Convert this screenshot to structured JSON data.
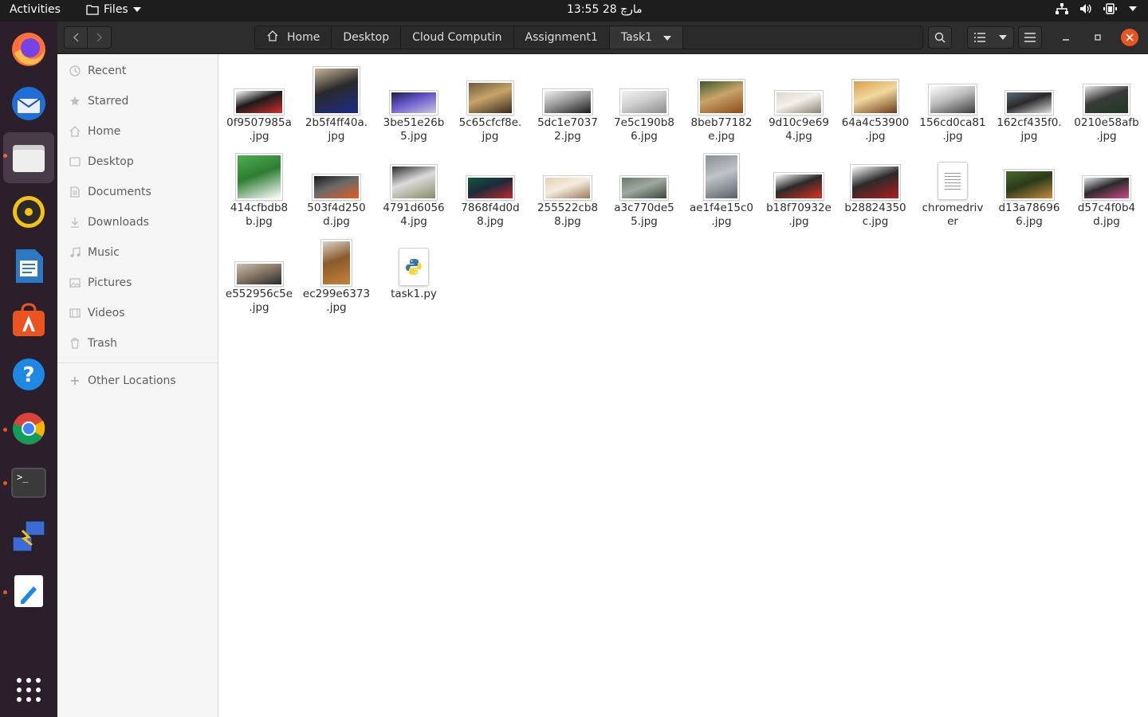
{
  "topbar": {
    "activities": "Activities",
    "app_menu": "Files",
    "clock": "مارچ 28  13:55"
  },
  "dock": {
    "apps": [
      {
        "name": "firefox",
        "color": "#ff7139"
      },
      {
        "name": "thunderbird",
        "color": "#2a6fd6"
      },
      {
        "name": "files",
        "color": "#9b9b9b"
      },
      {
        "name": "rhythmbox",
        "color": "#f5c211"
      },
      {
        "name": "libreoffice-writer",
        "color": "#2b78c5"
      },
      {
        "name": "ubuntu-software",
        "color": "#e95420"
      },
      {
        "name": "help",
        "color": "#1e88e5"
      },
      {
        "name": "chrome",
        "color": "#4285f4"
      },
      {
        "name": "terminal",
        "color": "#3a3a3a"
      },
      {
        "name": "remote-desktop",
        "color": "#3b6bd6"
      },
      {
        "name": "text-editor",
        "color": "#ffffff"
      }
    ],
    "show_apps": "show-applications-icon"
  },
  "header": {
    "breadcrumbs": [
      "Home",
      "Desktop",
      "Cloud Computin",
      "Assignment1",
      "Task1"
    ]
  },
  "sidebar": {
    "items": [
      {
        "label": "Recent",
        "icon": "clock-icon"
      },
      {
        "label": "Starred",
        "icon": "star-icon"
      },
      {
        "label": "Home",
        "icon": "home-icon"
      },
      {
        "label": "Desktop",
        "icon": "desktop-icon"
      },
      {
        "label": "Documents",
        "icon": "documents-icon"
      },
      {
        "label": "Downloads",
        "icon": "download-icon"
      },
      {
        "label": "Music",
        "icon": "music-icon"
      },
      {
        "label": "Pictures",
        "icon": "pictures-icon"
      },
      {
        "label": "Videos",
        "icon": "videos-icon"
      },
      {
        "label": "Trash",
        "icon": "trash-icon"
      }
    ],
    "other_locations": "Other Locations"
  },
  "files": [
    {
      "name": "0f9507985a.jpg",
      "line1": "0f9507985a",
      "line2": ".jpg",
      "kind": "image",
      "colors": [
        "#ffffff",
        "#d32f2f",
        "#1a1a1a"
      ]
    },
    {
      "name": "2b5f4ff40a.jpg",
      "line1": "2b5f4ff40a.",
      "line2": "jpg",
      "kind": "image",
      "colors": [
        "#c9b89a",
        "#1c2a8a",
        "#2a2a2a"
      ]
    },
    {
      "name": "3be51e26b5.jpg",
      "line1": "3be51e26b",
      "line2": "5.jpg",
      "kind": "image",
      "colors": [
        "#1b1f4a",
        "#c8c8d8",
        "#6a5acd"
      ]
    },
    {
      "name": "5c65cfcf8e.jpg",
      "line1": "5c65cfcf8e.",
      "line2": "jpg",
      "kind": "image",
      "colors": [
        "#6b5a3a",
        "#3a2a1a",
        "#c8a46a"
      ]
    },
    {
      "name": "5dc1e70372.jpg",
      "line1": "5dc1e7037",
      "line2": "2.jpg",
      "kind": "image",
      "colors": [
        "#f0f0f0",
        "#1a1a1a",
        "#9a9a9a"
      ]
    },
    {
      "name": "7e5c190b86.jpg",
      "line1": "7e5c190b8",
      "line2": "6.jpg",
      "kind": "image",
      "colors": [
        "#f2f2f2",
        "#8a8a8a",
        "#cfcfcf"
      ]
    },
    {
      "name": "8beb77182e.jpg",
      "line1": "8beb77182",
      "line2": "e.jpg",
      "kind": "image",
      "colors": [
        "#3a5a2a",
        "#8a4a1a",
        "#c8a46a"
      ]
    },
    {
      "name": "9d10c9e694.jpg",
      "line1": "9d10c9e69",
      "line2": "4.jpg",
      "kind": "image",
      "colors": [
        "#dcd8cf",
        "#8a8070",
        "#f4f0ea"
      ]
    },
    {
      "name": "64a4c53900.jpg",
      "line1": "64a4c53900",
      "line2": ".jpg",
      "kind": "image",
      "colors": [
        "#d9a04a",
        "#6a3a1a",
        "#f2d8a0"
      ]
    },
    {
      "name": "156cd0ca81.jpg",
      "line1": "156cd0ca81",
      "line2": ".jpg",
      "kind": "image",
      "colors": [
        "#ffffff",
        "#3a3a3a",
        "#bdbdbd"
      ]
    },
    {
      "name": "162cf435f0.jpg",
      "line1": "162cf435f0.",
      "line2": "jpg",
      "kind": "image",
      "colors": [
        "#5a6a7a",
        "#e0e0e0",
        "#2a2a2a"
      ]
    },
    {
      "name": "0210e58afb.jpg",
      "line1": "0210e58afb",
      "line2": ".jpg",
      "kind": "image",
      "colors": [
        "#e8e8e8",
        "#1e3a1e",
        "#3a3a3a"
      ]
    },
    {
      "name": "414cfbdb8b.jpg",
      "line1": "414cfbdb8",
      "line2": "b.jpg",
      "kind": "image",
      "colors": [
        "#4caf50",
        "#ffffff",
        "#2e7d32"
      ]
    },
    {
      "name": "503f4d250d.jpg",
      "line1": "503f4d250",
      "line2": "d.jpg",
      "kind": "image",
      "colors": [
        "#1a1a1a",
        "#e65c1a",
        "#6a6a6a"
      ]
    },
    {
      "name": "4791d60564.jpg",
      "line1": "4791d6056",
      "line2": "4.jpg",
      "kind": "image",
      "colors": [
        "#2a2a2a",
        "#8a8a6a",
        "#dcdcdc"
      ]
    },
    {
      "name": "7868f4d0d8.jpg",
      "line1": "7868f4d0d",
      "line2": "8.jpg",
      "kind": "image",
      "colors": [
        "#0e5a3a",
        "#c8282a",
        "#1a2a3a"
      ]
    },
    {
      "name": "255522cb88.jpg",
      "line1": "255522cb8",
      "line2": "8.jpg",
      "kind": "image",
      "colors": [
        "#e8d0b0",
        "#9a7a5a",
        "#f4ece0"
      ]
    },
    {
      "name": "a3c770de55.jpg",
      "line1": "a3c770de5",
      "line2": "5.jpg",
      "kind": "image",
      "colors": [
        "#6a7a6a",
        "#3a4a3a",
        "#a0a8a0"
      ]
    },
    {
      "name": "ae1f4e15c0.jpg",
      "line1": "ae1f4e15c0",
      "line2": ".jpg",
      "kind": "image",
      "colors": [
        "#8a8f96",
        "#5a6068",
        "#c0c4c8"
      ]
    },
    {
      "name": "b18f70932e.jpg",
      "line1": "b18f70932e",
      "line2": ".jpg",
      "kind": "image",
      "colors": [
        "#ffffff",
        "#e0301e",
        "#2a2a2a"
      ]
    },
    {
      "name": "b28824350c.jpg",
      "line1": "b28824350",
      "line2": "c.jpg",
      "kind": "image",
      "colors": [
        "#ffffff",
        "#b01e1e",
        "#2a2a2a"
      ]
    },
    {
      "name": "chromedriver",
      "line1": "chromedriv",
      "line2": "er",
      "kind": "doc",
      "colors": []
    },
    {
      "name": "d13a786966.jpg",
      "line1": "d13a78696",
      "line2": "6.jpg",
      "kind": "image",
      "colors": [
        "#4a6a2a",
        "#c88a3a",
        "#2a3a1a"
      ]
    },
    {
      "name": "d57c4f0b4d.jpg",
      "line1": "d57c4f0b4",
      "line2": "d.jpg",
      "kind": "image",
      "colors": [
        "#e8e8f0",
        "#d04a8a",
        "#2a2a2a"
      ]
    },
    {
      "name": "e552956c5e.jpg",
      "line1": "e552956c5e",
      "line2": ".jpg",
      "kind": "image",
      "colors": [
        "#c8c0b0",
        "#2a2a2a",
        "#8a7a6a"
      ]
    },
    {
      "name": "ec299e6373.jpg",
      "line1": "ec299e6373",
      "line2": ".jpg",
      "kind": "image",
      "colors": [
        "#d8d2c6",
        "#c8823a",
        "#8a5a2a"
      ]
    },
    {
      "name": "task1.py",
      "line1": "task1.py",
      "line2": "",
      "kind": "python",
      "colors": []
    }
  ]
}
